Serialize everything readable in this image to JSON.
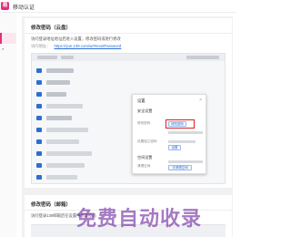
{
  "app": {
    "logo_glyph": "易",
    "title": "移动认证"
  },
  "section1": {
    "title": "修改密码（云盘）",
    "desc": "访问登录地址地址后进入设置，修改密码或进行修改",
    "link_label": "访问地址：",
    "link_text": "https://yun.139.com/w/#resetPassword"
  },
  "modal": {
    "title": "设置",
    "close": "×",
    "sec1": "安全设置",
    "row1_label": "修改密码",
    "row1_button": "修改密码",
    "row2_label": "设置独立密码",
    "row2_button": "设置",
    "sec2": "空间设置",
    "row3_label": "清理空间",
    "row3_button": "去清理空间"
  },
  "section2": {
    "title": "修改密码（邮箱）",
    "desc": "访问登录139邮箱后在设置中修改密码"
  },
  "watermark": "免费自动收录"
}
